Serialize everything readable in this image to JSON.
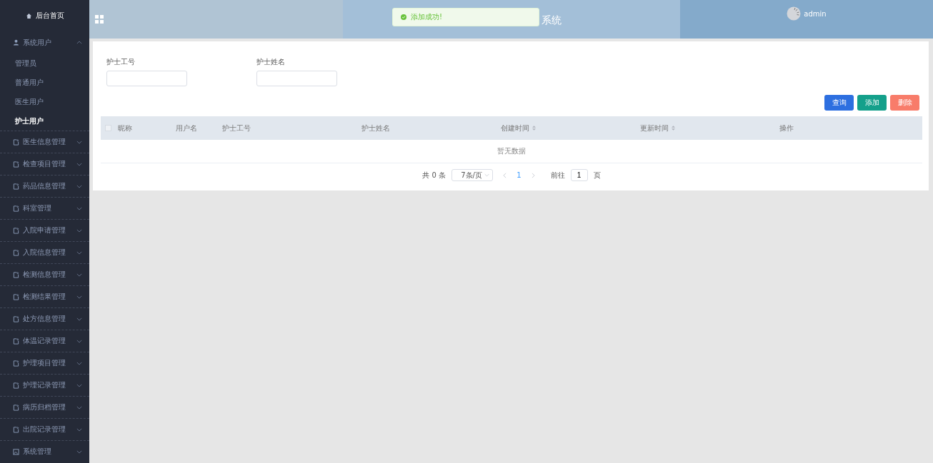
{
  "sidebar": {
    "home": "后台首页",
    "groups": [
      {
        "label": "系统用户",
        "kind": "user",
        "expanded": true,
        "children": [
          {
            "label": "管理员",
            "selected": false
          },
          {
            "label": "普通用户",
            "selected": false
          },
          {
            "label": "医生用户",
            "selected": false
          },
          {
            "label": "护士用户",
            "selected": true
          }
        ]
      },
      {
        "label": "医生信息管理",
        "kind": "doc",
        "expanded": false
      },
      {
        "label": "检查项目管理",
        "kind": "doc",
        "expanded": false
      },
      {
        "label": "药品信息管理",
        "kind": "doc",
        "expanded": false
      },
      {
        "label": "科室管理",
        "kind": "doc",
        "expanded": false
      },
      {
        "label": "入院申请管理",
        "kind": "doc",
        "expanded": false
      },
      {
        "label": "入院信息管理",
        "kind": "doc",
        "expanded": false
      },
      {
        "label": "检测信息管理",
        "kind": "doc",
        "expanded": false
      },
      {
        "label": "检测结果管理",
        "kind": "doc",
        "expanded": false
      },
      {
        "label": "处方信息管理",
        "kind": "doc",
        "expanded": false
      },
      {
        "label": "体温记录管理",
        "kind": "doc",
        "expanded": false
      },
      {
        "label": "护理项目管理",
        "kind": "doc",
        "expanded": false
      },
      {
        "label": "护理记录管理",
        "kind": "doc",
        "expanded": false
      },
      {
        "label": "病历归档管理",
        "kind": "doc",
        "expanded": false
      },
      {
        "label": "出院记录管理",
        "kind": "doc",
        "expanded": false
      },
      {
        "label": "系统管理",
        "kind": "system",
        "expanded": false
      }
    ]
  },
  "header": {
    "title": "系统",
    "user": "admin"
  },
  "toast": {
    "message": "添加成功!"
  },
  "filters": [
    {
      "label": "护士工号"
    },
    {
      "label": "护士姓名"
    }
  ],
  "buttons": [
    {
      "label": "查询",
      "kind": "primary"
    },
    {
      "label": "添加",
      "kind": "success"
    },
    {
      "label": "删除",
      "kind": "danger"
    }
  ],
  "table": {
    "select_all": {
      "checked": false
    },
    "columns": [
      {
        "label": "昵称",
        "sortable": false
      },
      {
        "label": "用户名",
        "sortable": false
      },
      {
        "label": "护士工号",
        "sortable": false
      },
      {
        "label": "护士姓名",
        "sortable": false
      },
      {
        "label": "创建时间",
        "sortable": true
      },
      {
        "label": "更新时间",
        "sortable": true
      },
      {
        "label": "操作",
        "sortable": false
      }
    ],
    "empty_text": "暂无数据"
  },
  "pagination": {
    "total": "共 0 条",
    "page_size": "7条/页",
    "pages": [
      {
        "label": "1",
        "selected": true
      }
    ],
    "goto": "前往",
    "goto_value": "1",
    "goto_suffix": "页"
  }
}
